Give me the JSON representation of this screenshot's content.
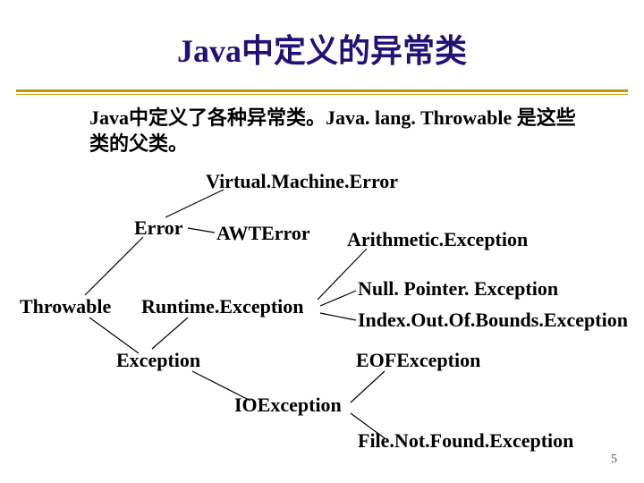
{
  "title": "Java中定义的异常类",
  "intro": "Java中定义了各种异常类。Java. lang. Throwable 是这些类的父类。",
  "nodes": {
    "throwable": "Throwable",
    "error": "Error",
    "vmerror": "Virtual.Machine.Error",
    "awterror": "AWTError",
    "exception": "Exception",
    "runtime": "Runtime.Exception",
    "arith": "Arithmetic.Exception",
    "npe": "Null. Pointer. Exception",
    "ioob": "Index.Out.Of.Bounds.Exception",
    "ioexception": "IOException",
    "eof": "EOFException",
    "fnf": "File.Not.Found.Exception"
  },
  "page": "5",
  "chart_data": {
    "type": "tree",
    "root": "Throwable",
    "edges": [
      [
        "Throwable",
        "Error"
      ],
      [
        "Throwable",
        "Exception"
      ],
      [
        "Error",
        "Virtual.Machine.Error"
      ],
      [
        "Error",
        "AWTError"
      ],
      [
        "Exception",
        "Runtime.Exception"
      ],
      [
        "Exception",
        "IOException"
      ],
      [
        "Runtime.Exception",
        "Arithmetic.Exception"
      ],
      [
        "Runtime.Exception",
        "Null. Pointer. Exception"
      ],
      [
        "Runtime.Exception",
        "Index.Out.Of.Bounds.Exception"
      ],
      [
        "IOException",
        "EOFException"
      ],
      [
        "IOException",
        "File.Not.Found.Exception"
      ]
    ]
  }
}
